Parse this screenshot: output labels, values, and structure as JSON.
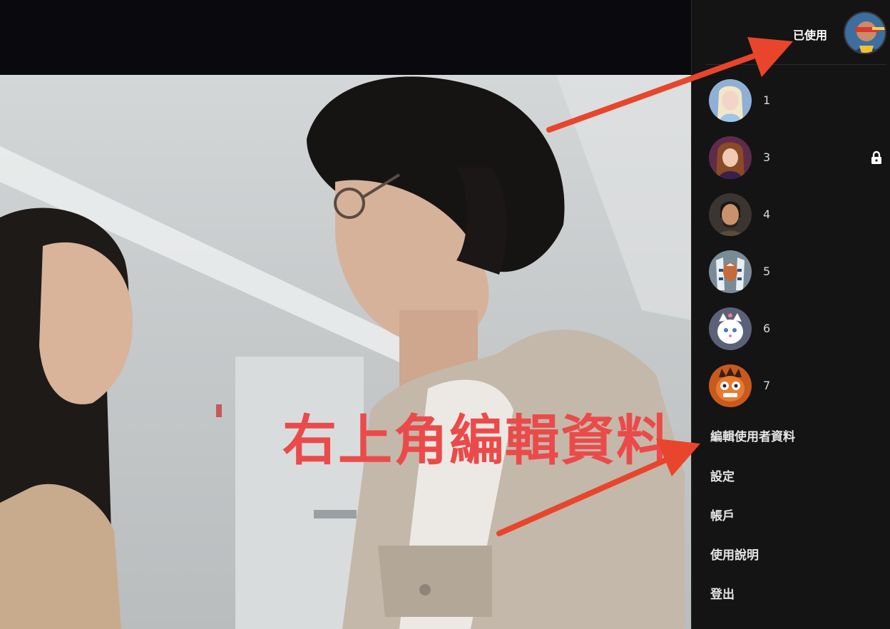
{
  "account": {
    "current_label": "已使用",
    "current_avatar_icon": "cyclops-avatar-icon"
  },
  "profiles": [
    {
      "name": "1",
      "avatar_icon": "elsa-avatar-icon",
      "locked": false
    },
    {
      "name": "3",
      "avatar_icon": "anna-avatar-icon",
      "locked": true
    },
    {
      "name": "4",
      "avatar_icon": "bearded-man-avatar-icon",
      "locked": false
    },
    {
      "name": "5",
      "avatar_icon": "ahsoka-avatar-icon",
      "locked": false
    },
    {
      "name": "6",
      "avatar_icon": "marie-cat-avatar-icon",
      "locked": false
    },
    {
      "name": "7",
      "avatar_icon": "anxiety-avatar-icon",
      "locked": false
    }
  ],
  "menu": {
    "edit_profiles": "編輯使用者資料",
    "settings": "設定",
    "account": "帳戶",
    "help": "使用說明",
    "logout": "登出"
  },
  "annotation": {
    "text": "右上角編輯資料",
    "color": "#ea4b4a",
    "arrow_color": "#e8452c"
  }
}
